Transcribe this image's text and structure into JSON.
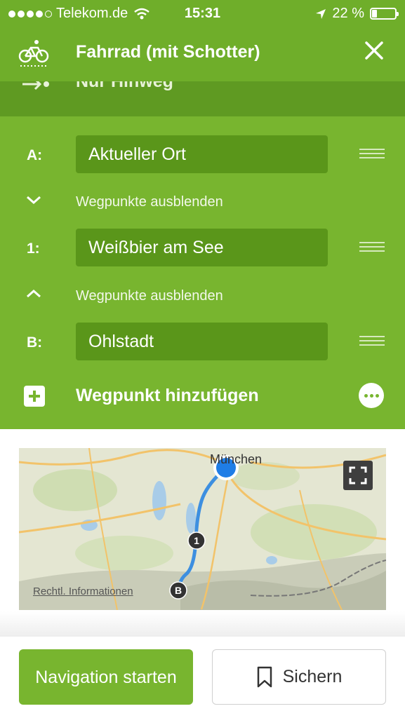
{
  "status_bar": {
    "carrier": "Telekom.de",
    "time": "15:31",
    "battery": "22 %"
  },
  "header": {
    "title": "Fahrrad (mit Schotter)",
    "icon": "bike-icon"
  },
  "previous_row": {
    "text": "Nur Hinweg"
  },
  "waypoints": [
    {
      "label": "A:",
      "value": "Aktueller Ort"
    },
    {
      "label": "1:",
      "value": "Weißbier am See"
    },
    {
      "label": "B:",
      "value": "Ohlstadt"
    }
  ],
  "toggles": [
    {
      "text": "Wegpunkte ausblenden",
      "icon": "chevron-down-icon"
    },
    {
      "text": "Wegpunkte ausblenden",
      "icon": "chevron-up-icon"
    }
  ],
  "add_waypoint": {
    "label": "Wegpunkt hinzufügen"
  },
  "map": {
    "city_label": "München",
    "credits": "Rechtl. Informationen",
    "marker_1": "1",
    "marker_b": "B"
  },
  "buttons": {
    "navigate": "Navigation starten",
    "save": "Sichern"
  },
  "colors": {
    "primary_green": "#78b52f",
    "header_green": "#6fae2a",
    "field_green": "#5a961a",
    "route_blue": "#3d8fe0"
  }
}
